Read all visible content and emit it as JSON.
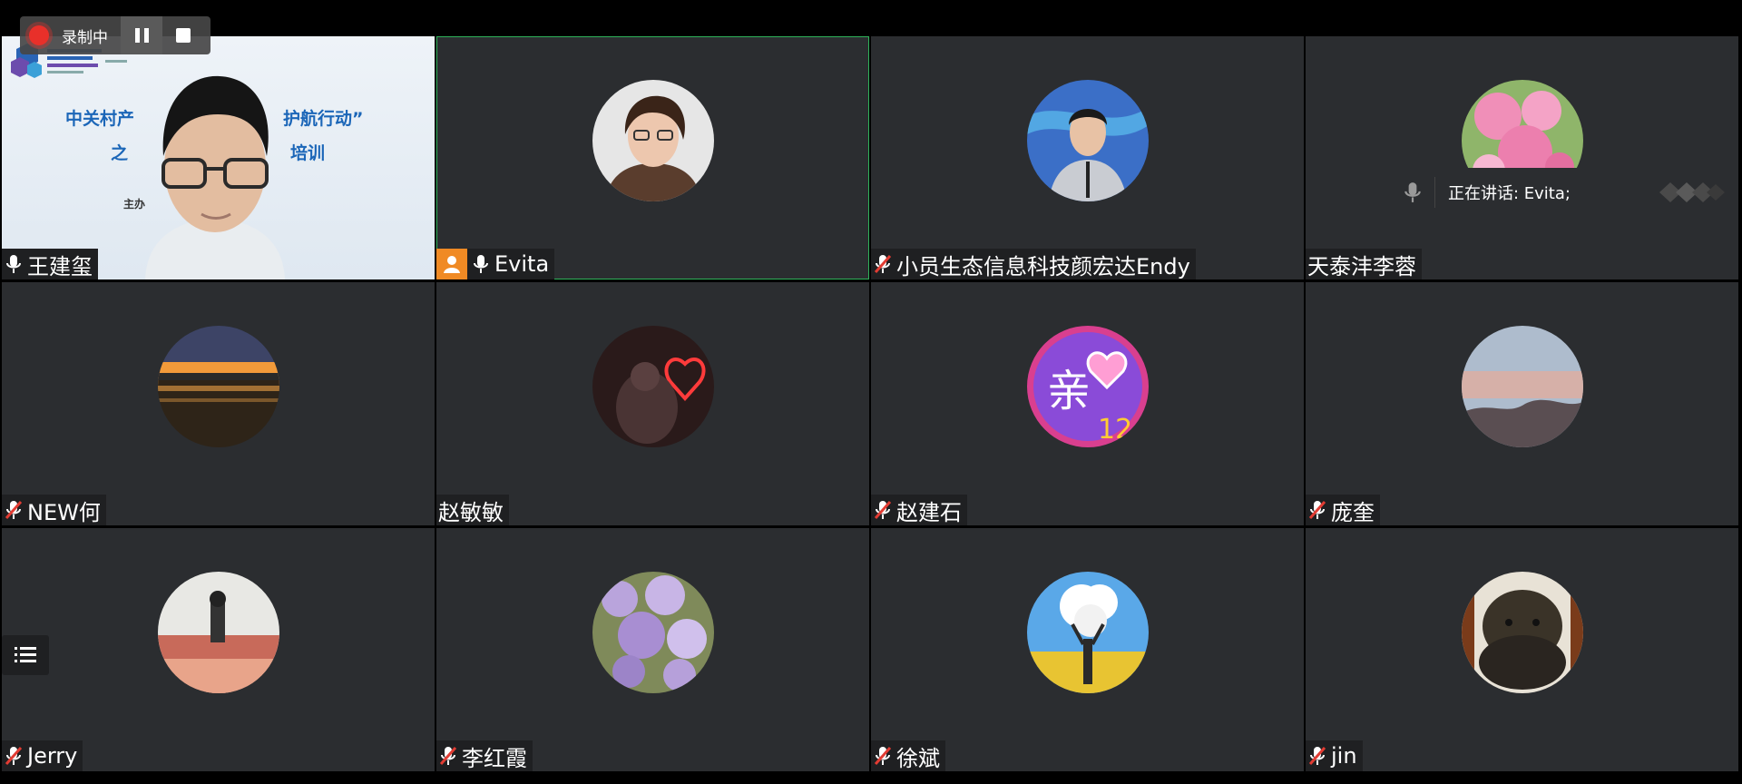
{
  "recording": {
    "status_label": "录制中"
  },
  "speaking": {
    "text": "正在讲话: Evita;"
  },
  "slide": {
    "line1a": "中关村产",
    "line1b": "护航行动”",
    "line2a": "之",
    "line2b": "培训",
    "line3": "主办"
  },
  "participants": [
    {
      "name": "王建玺",
      "mic": "on"
    },
    {
      "name": "Evita",
      "mic": "on",
      "host": true,
      "active": true
    },
    {
      "name": "小员生态信息科技颜宏达Endy",
      "mic": "muted"
    },
    {
      "name": "天泰沣李蓉",
      "mic": "none"
    },
    {
      "name": "NEW何",
      "mic": "muted"
    },
    {
      "name": "赵敏敏",
      "mic": "none"
    },
    {
      "name": "赵建石",
      "mic": "muted"
    },
    {
      "name": "庞奎",
      "mic": "muted"
    },
    {
      "name": "Jerry",
      "mic": "muted"
    },
    {
      "name": "李红霞",
      "mic": "muted"
    },
    {
      "name": "徐斌",
      "mic": "muted"
    },
    {
      "name": "jin",
      "mic": "muted"
    }
  ],
  "colors": {
    "tile_bg": "#2b2d30",
    "active_border": "#2fb35a",
    "record_red": "#e8302a",
    "host_badge": "#f08a24"
  }
}
